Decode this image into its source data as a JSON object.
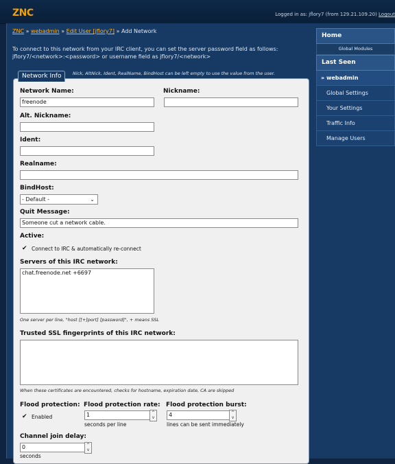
{
  "app": {
    "logo": "ZNC",
    "logged_in_prefix": "Logged in as: ",
    "logged_in_user": "jflory7 (from 129.21.109.20) ",
    "logout": "Logout"
  },
  "breadcrumb": {
    "items": [
      "ZNC",
      "webadmin",
      "Edit User [jflory7]"
    ],
    "current": "Add Network"
  },
  "intro_text": "To connect to this network from your IRC client, you can set the server password field as follows: jflory7/<network>:<password> or username field as jflory7/<network>",
  "fieldset": {
    "legend": "Network Info",
    "hint": "Nick, AltNick, Ident, RealName, BindHost can be left empty to use the value from the user."
  },
  "form": {
    "network_name_label": "Network Name:",
    "network_name_value": "freenode",
    "nickname_label": "Nickname:",
    "nickname_value": "",
    "alt_nick_label": "Alt. Nickname:",
    "alt_nick_value": "",
    "ident_label": "Ident:",
    "ident_value": "",
    "realname_label": "Realname:",
    "realname_value": "",
    "bindhost_label": "BindHost:",
    "bindhost_value": "- Default -",
    "quit_label": "Quit Message:",
    "quit_value": "Someone cut a network cable.",
    "active_label": "Active:",
    "active_checkbox_label": "Connect to IRC & automatically re-connect",
    "active_checked": true,
    "servers_label": "Servers of this IRC network:",
    "servers_value": "chat.freenode.net +6697",
    "servers_note": "One server per line, \"host [[+]port] [password]\", + means SSL",
    "ssl_label": "Trusted SSL fingerprints of this IRC network:",
    "ssl_value": "",
    "ssl_note": "When these certificates are encountered, checks for hostname, expiration date, CA are skipped",
    "flood_label": "Flood protection:",
    "flood_enabled_label": "Enabled",
    "flood_enabled": true,
    "flood_rate_label": "Flood protection rate:",
    "flood_rate_value": "1",
    "flood_rate_unit": "seconds per line",
    "flood_burst_label": "Flood protection burst:",
    "flood_burst_value": "4",
    "flood_burst_unit": "lines can be sent immediately",
    "join_delay_label": "Channel join delay:",
    "join_delay_value": "0",
    "join_delay_unit": "seconds"
  },
  "sidebar": {
    "home": "Home",
    "global_modules": "Global Modules",
    "last_seen": "Last Seen",
    "items": [
      "» webadmin",
      "Global Settings",
      "Your Settings",
      "Traffic Info",
      "Manage Users"
    ]
  },
  "colors": {
    "accent": "#f2a000",
    "link": "#ffb020",
    "background": "#173a64"
  }
}
